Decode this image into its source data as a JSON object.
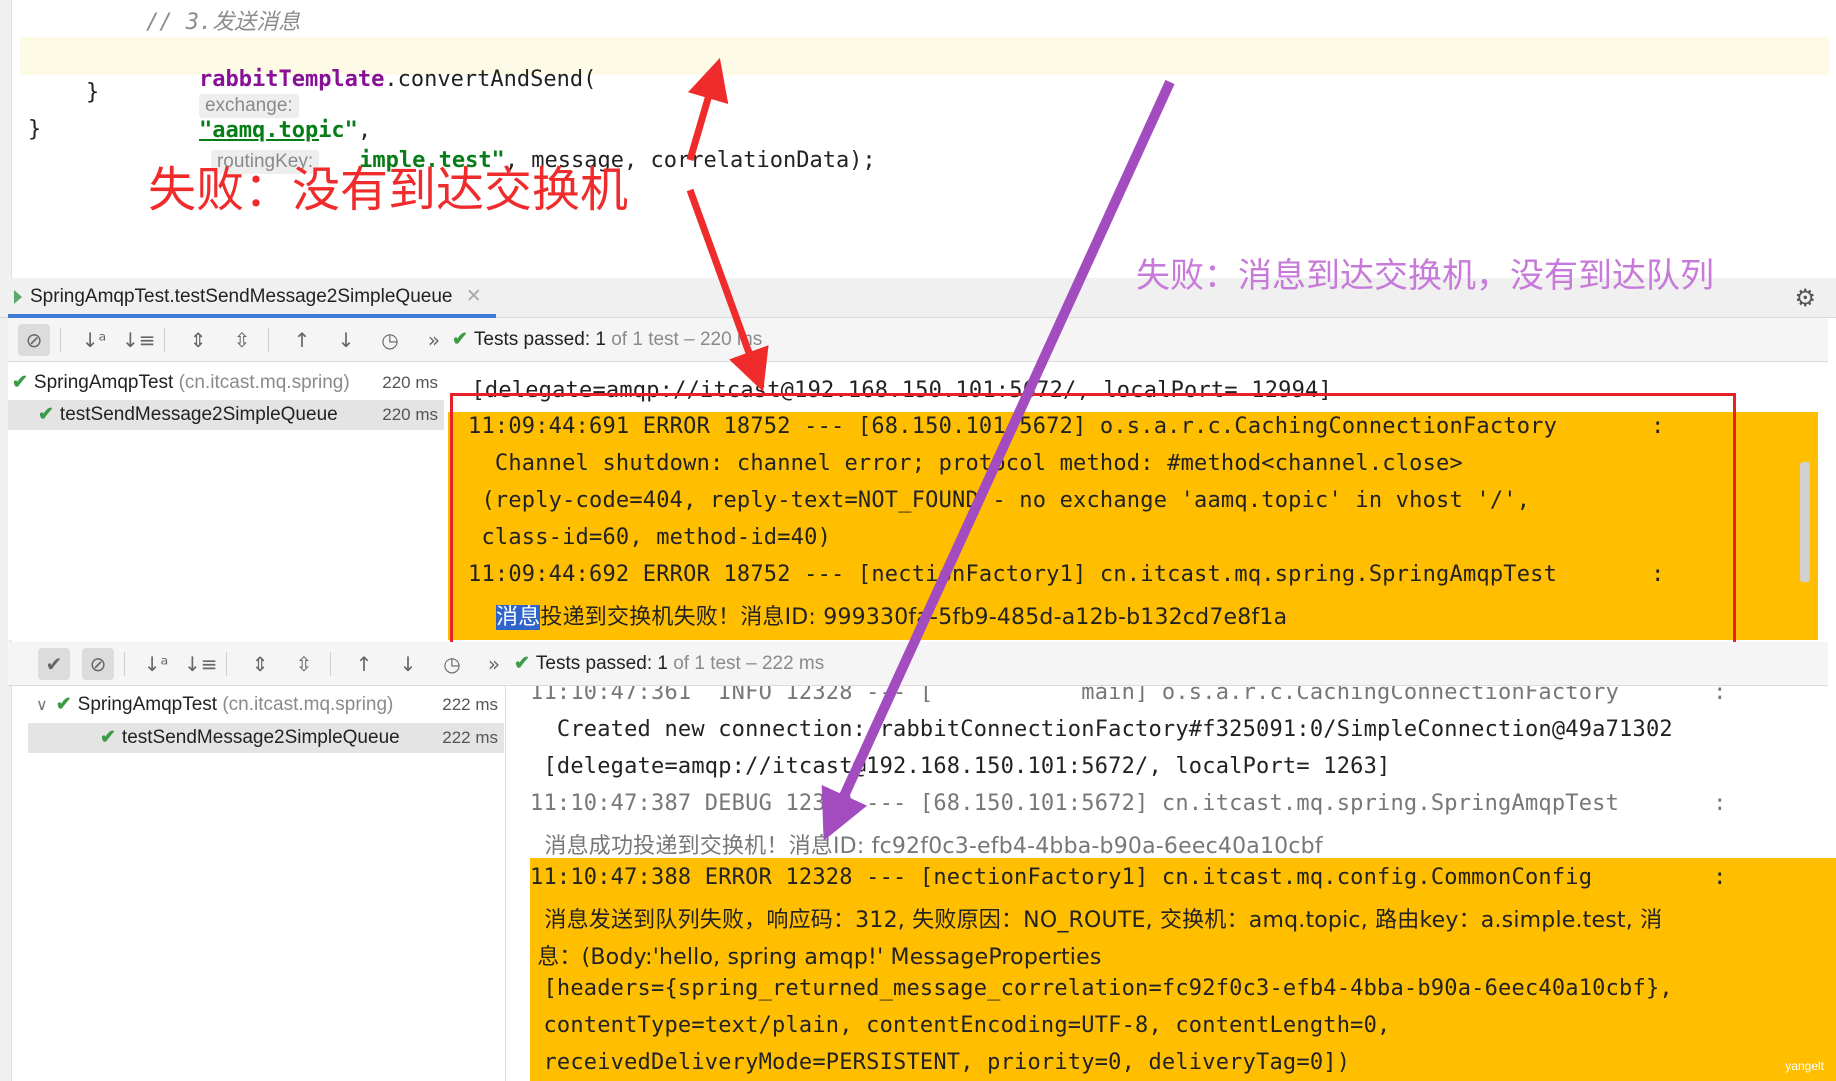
{
  "editor": {
    "comment": "// 3.发送消息",
    "line_field": "rabbitTemplate",
    "line_method": ".convertAndSend(",
    "hint_exchange": "exchange:",
    "exchange_value": "\"aamq.topic\"",
    "comma1": ",",
    "hint_routing_key": "routingKey:",
    "routing_key_value": "imple.test\"",
    "line_rest": ", message, correlationData);",
    "brace_inner": "}",
    "brace_outer": "}"
  },
  "annotations": {
    "red": "失败：没有到达交换机",
    "purple": "失败：消息到达交换机，没有到达队列"
  },
  "panel1": {
    "tab_title": "SpringAmqpTest.testSendMessage2SimpleQueue",
    "status_prefix": "Tests passed:",
    "status_count": "1",
    "status_rest": "of 1 test – 220 ms",
    "tree": [
      {
        "name": "SpringAmqpTest",
        "pkg": "(cn.itcast.mq.spring)",
        "time": "220 ms"
      },
      {
        "name": "testSendMessage2SimpleQueue",
        "time": "220 ms"
      }
    ],
    "console": [
      " [delegate=amqp://itcast@192.168.150.101:5672/, localPort= 12994]",
      "11:09:44:691 ERROR 18752 --- [68.150.101:5672] o.s.a.r.c.CachingConnectionFactory       :",
      "  Channel shutdown: channel error; protocol method: #method<channel.close>",
      " (reply-code=404, reply-text=NOT_FOUND - no exchange 'aamq.topic' in vhost '/',",
      " class-id=60, method-id=40)",
      "11:09:44:692 ERROR 18752 --- [nectionFactory1] cn.itcast.mq.spring.SpringAmqpTest       :"
    ],
    "console_last_selected": "消息",
    "console_last_rest": "投递到交换机失败！消息ID: 999330fa-5fb9-485d-a12b-b132cd7e8f1a"
  },
  "panel2": {
    "status_prefix": "Tests passed:",
    "status_count": "1",
    "status_rest": "of 1 test – 222 ms",
    "tree": [
      {
        "name": "SpringAmqpTest",
        "pkg": "(cn.itcast.mq.spring)",
        "time": "222 ms"
      },
      {
        "name": "testSendMessage2SimpleQueue",
        "time": "222 ms"
      }
    ],
    "console": [
      "11:10:47:361  INFO 12328 --- [           main] o.s.a.r.c.CachingConnectionFactory       :",
      "  Created new connection: rabbitConnectionFactory#f325091:0/SimpleConnection@49a71302",
      " [delegate=amqp://itcast@192.168.150.101:5672/, localPort= 1263]",
      "11:10:47:387 DEBUG 12328 --- [68.150.101:5672] cn.itcast.mq.spring.SpringAmqpTest       :",
      "  消息成功投递到交换机！消息ID: fc92f0c3-efb4-4bba-b90a-6eec40a10cbf",
      "11:10:47:388 ERROR 12328 --- [nectionFactory1] cn.itcast.mq.config.CommonConfig         :",
      "  消息发送到队列失败，响应码：312, 失败原因：NO_ROUTE, 交换机：amq.topic, 路由key：a.simple.test, 消",
      " 息：(Body:'hello, spring amqp!' MessageProperties",
      " [headers={spring_returned_message_correlation=fc92f0c3-efb4-4bba-b90a-6eec40a10cbf},",
      " contentType=text/plain, contentEncoding=UTF-8, contentLength=0,",
      " receivedDeliveryMode=PERSISTENT, priority=0, deliveryTag=0])"
    ]
  },
  "watermark": "yangelt",
  "colors": {
    "error_highlight": "#ffbe00",
    "red_annotation": "#ef2b2b",
    "purple_annotation": "#c77ad9",
    "purple_arrow": "#a34cc0",
    "red_box": "#e8202a",
    "pass_green": "#3c9b46"
  },
  "icons": [
    "stop-icon",
    "sort-alpha-icon",
    "sort-duration-icon",
    "expand-all-icon",
    "collapse-all-icon",
    "previous-failed-icon",
    "next-failed-icon",
    "history-icon",
    "more-icon",
    "gear-icon",
    "check-icon"
  ]
}
